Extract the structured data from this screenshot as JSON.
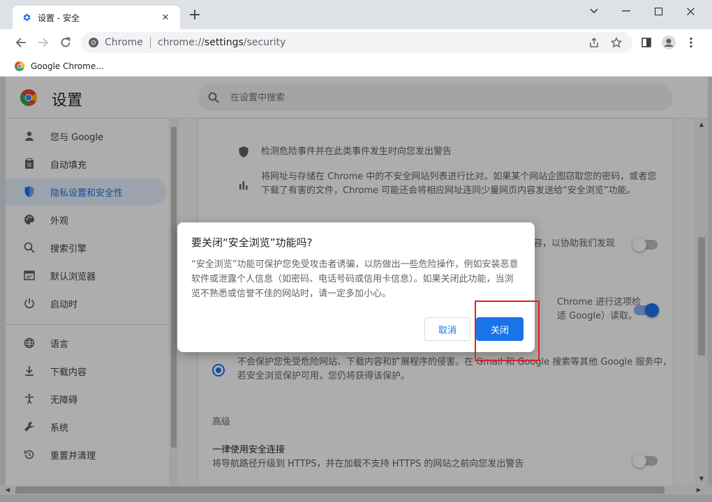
{
  "tab": {
    "title": "设置 - 安全",
    "close": "✕",
    "new_tab": "+"
  },
  "window_controls": {
    "minimize": "—",
    "maximize": "☐",
    "close": "✕",
    "chevron": "⌄"
  },
  "omnibox": {
    "site_label": "Chrome",
    "url_scheme": "chrome://",
    "url_host": "settings",
    "url_path": "/security"
  },
  "bookmarks": [
    {
      "label": "Google Chrome..."
    }
  ],
  "settings": {
    "title": "设置",
    "search_placeholder": "在设置中搜索",
    "sidebar": [
      {
        "label": "您与 Google",
        "icon": "person-icon"
      },
      {
        "label": "自动填充",
        "icon": "clipboard-icon"
      },
      {
        "label": "隐私设置和安全性",
        "icon": "shield-icon",
        "active": true
      },
      {
        "label": "外观",
        "icon": "palette-icon"
      },
      {
        "label": "搜索引擎",
        "icon": "search-icon"
      },
      {
        "label": "默认浏览器",
        "icon": "browser-icon"
      },
      {
        "label": "启动时",
        "icon": "power-icon"
      },
      {
        "label": "语言",
        "icon": "globe-icon"
      },
      {
        "label": "下载内容",
        "icon": "download-icon"
      },
      {
        "label": "无障碍",
        "icon": "accessibility-icon"
      },
      {
        "label": "系统",
        "icon": "wrench-icon"
      },
      {
        "label": "重置并清理",
        "icon": "restore-icon"
      }
    ],
    "content": {
      "row1": "检测危险事件并在此类事件发生时向您发出警告",
      "row2_line1": "将网址与存储在 Chrome 中的不安全网站列表进行比对。如果某个网站企图窃取您的密码，或者您",
      "row2_line2": "下载了有害的文件，Chrome 可能还会将相应网址连同少量网页内容发送给“安全浏览”功能。",
      "row3_partial": "容，以协助我们发现",
      "row4_line1": "Chrome 进行这项检",
      "row4_line2": "适 Google）读取。",
      "no_protect_line1": "不会保护您免受危险网站、下载内容和扩展程序的侵害。在 Gmail 和 Google 搜索等其他 Google 服务中，",
      "no_protect_line2": "若安全浏览保护可用，您仍将获得该保护。",
      "advanced_heading": "高级",
      "https_title": "一律使用安全连接",
      "https_desc": "将导航路径升级到 HTTPS，并在加载不支持 HTTPS 的网站之前向您发出警告"
    }
  },
  "dialog": {
    "title": "要关闭“安全浏览”功能吗?",
    "body": "“安全浏览”功能可保护您免受攻击者诱骗，以防做出一些危险操作，例如安装恶意软件或泄露个人信息（如密码、电话号码或信用卡信息）。如果关闭此功能，当浏览不熟悉或信誉不佳的网站时，请一定多加小心。",
    "cancel_label": "取消",
    "confirm_label": "关闭"
  },
  "colors": {
    "accent": "#1a73e8",
    "highlight": "#e02020"
  }
}
